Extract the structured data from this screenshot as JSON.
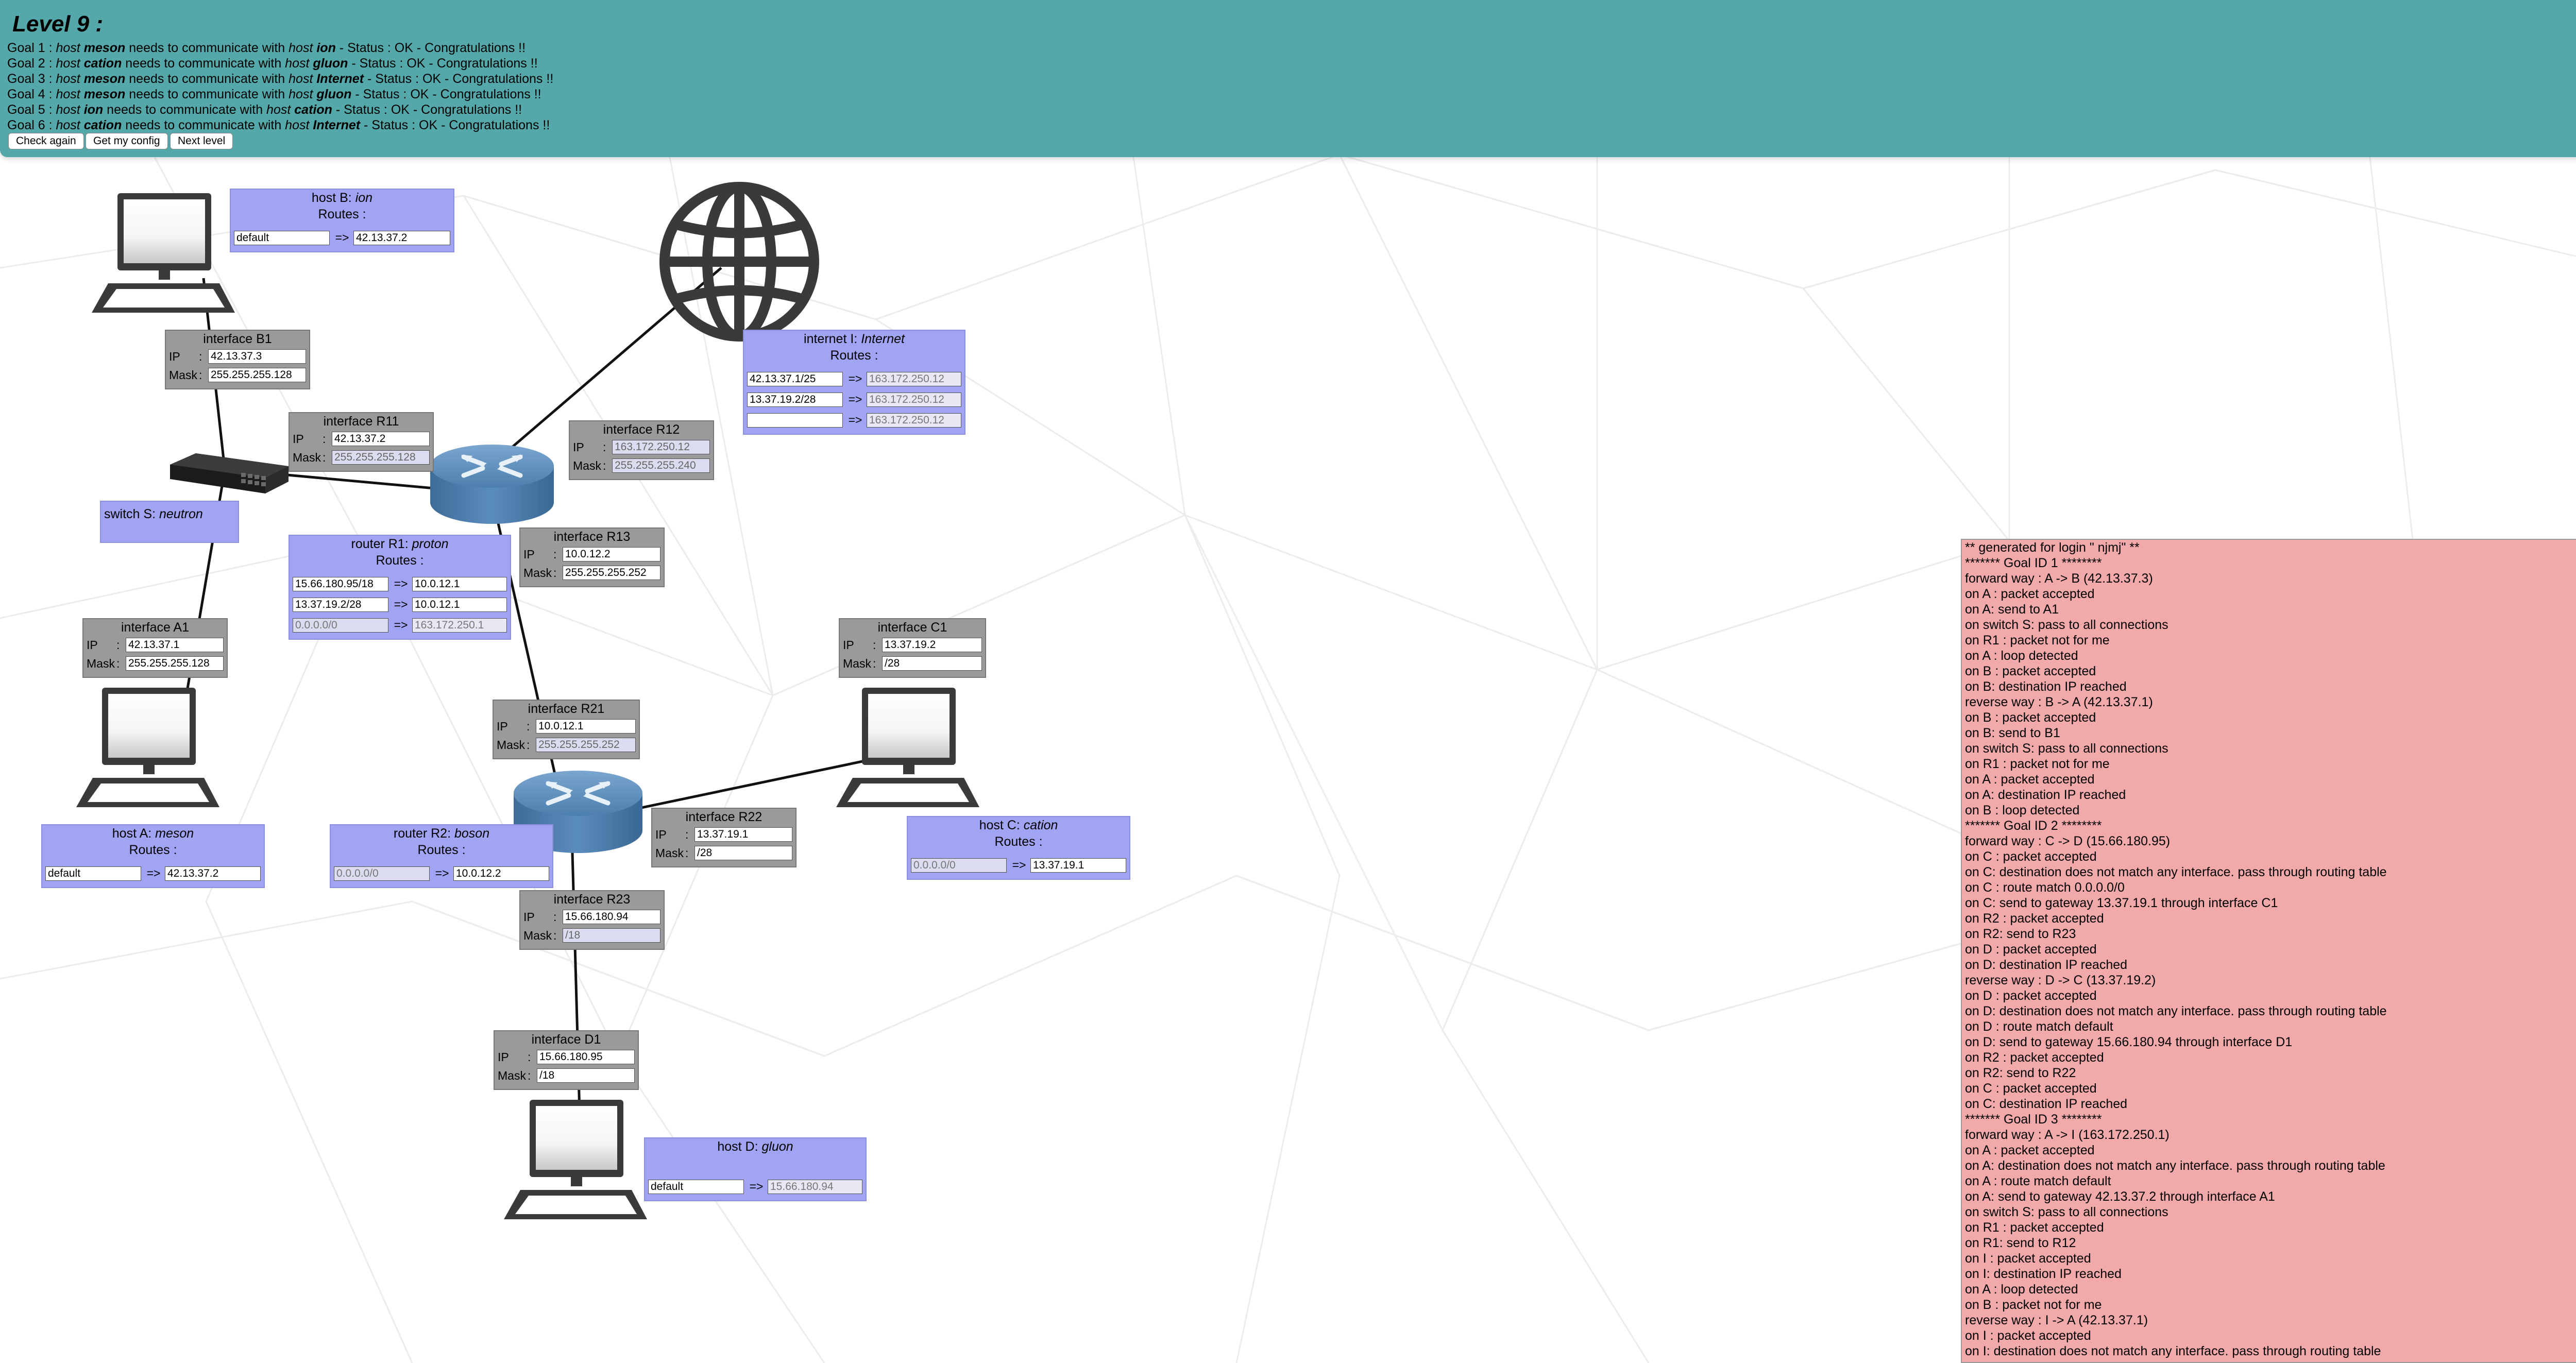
{
  "level_title": "Level 9 :",
  "goals": [
    {
      "prefix": "Goal 1 : ",
      "src_word": "host",
      "src_name": "meson",
      "mid": " needs to communicate with ",
      "dst_word": "host",
      "dst_name": "ion",
      "status": " - Status : OK - Congratulations !!"
    },
    {
      "prefix": "Goal 2 : ",
      "src_word": "host",
      "src_name": "cation",
      "mid": " needs to communicate with ",
      "dst_word": "host",
      "dst_name": "gluon",
      "status": " - Status : OK - Congratulations !!"
    },
    {
      "prefix": "Goal 3 : ",
      "src_word": "host",
      "src_name": "meson",
      "mid": " needs to communicate with ",
      "dst_word": "host",
      "dst_name": "Internet",
      "status": " - Status : OK - Congratulations !!"
    },
    {
      "prefix": "Goal 4 : ",
      "src_word": "host",
      "src_name": "meson",
      "mid": " needs to communicate with ",
      "dst_word": "host",
      "dst_name": "gluon",
      "status": " - Status : OK - Congratulations !!"
    },
    {
      "prefix": "Goal 5 : ",
      "src_word": "host",
      "src_name": "ion",
      "mid": " needs to communicate with ",
      "dst_word": "host",
      "dst_name": "cation",
      "status": " - Status : OK - Congratulations !!"
    },
    {
      "prefix": "Goal 6 : ",
      "src_word": "host",
      "src_name": "cation",
      "mid": " needs to communicate with ",
      "dst_word": "host",
      "dst_name": "Internet",
      "status": " - Status : OK - Congratulations !!"
    }
  ],
  "buttons": {
    "check": "Check again",
    "config": "Get my config",
    "next": "Next level"
  },
  "labels": {
    "ip": "IP",
    "mask": "Mask",
    "colon": ":",
    "routes": "Routes :",
    "arrow": "=>"
  },
  "interfaces": {
    "B1": {
      "title": "interface B1",
      "ip": "42.13.37.3",
      "mask": "255.255.255.128"
    },
    "R11": {
      "title": "interface R11",
      "ip": "42.13.37.2",
      "mask": "255.255.255.128"
    },
    "R12": {
      "title": "interface R12",
      "ip": "163.172.250.12",
      "mask": "255.255.255.240"
    },
    "R13": {
      "title": "interface R13",
      "ip": "10.0.12.2",
      "mask": "255.255.255.252"
    },
    "A1": {
      "title": "interface A1",
      "ip": "42.13.37.1",
      "mask": "255.255.255.128"
    },
    "C1": {
      "title": "interface C1",
      "ip": "13.37.19.2",
      "mask": "/28"
    },
    "R21": {
      "title": "interface R21",
      "ip": "10.0.12.1",
      "mask": "255.255.255.252"
    },
    "R22": {
      "title": "interface R22",
      "ip": "13.37.19.1",
      "mask": "/28"
    },
    "R23": {
      "title": "interface R23",
      "ip": "15.66.180.94",
      "mask": "/18"
    },
    "D1": {
      "title": "interface D1",
      "ip": "15.66.180.95",
      "mask": "/18"
    }
  },
  "hosts": {
    "B": {
      "title_prefix": "host B: ",
      "title_name": "ion",
      "routes": [
        {
          "dest": "default",
          "gw": "42.13.37.2"
        }
      ]
    },
    "I": {
      "title_prefix": "internet I: ",
      "title_name": "Internet",
      "routes": [
        {
          "dest": "42.13.37.1/25",
          "gw": "163.172.250.12"
        },
        {
          "dest": "13.37.19.2/28",
          "gw": "163.172.250.12"
        },
        {
          "dest": "",
          "gw": "163.172.250.12"
        }
      ]
    },
    "R1": {
      "title_prefix": "router R1: ",
      "title_name": "proton",
      "routes": [
        {
          "dest": "15.66.180.95/18",
          "gw": "10.0.12.1"
        },
        {
          "dest": "13.37.19.2/28",
          "gw": "10.0.12.1"
        },
        {
          "dest": "0.0.0.0/0",
          "gw": "163.172.250.1"
        }
      ]
    },
    "A": {
      "title_prefix": "host A: ",
      "title_name": "meson",
      "routes": [
        {
          "dest": "default",
          "gw": "42.13.37.2"
        }
      ]
    },
    "R2": {
      "title_prefix": "router R2: ",
      "title_name": "boson",
      "routes": [
        {
          "dest": "0.0.0.0/0",
          "gw": "10.0.12.2"
        }
      ]
    },
    "C": {
      "title_prefix": "host C: ",
      "title_name": "cation",
      "routes": [
        {
          "dest": "0.0.0.0/0",
          "gw": "13.37.19.1"
        }
      ]
    },
    "D": {
      "title_prefix": "host D: ",
      "title_name": "gluon",
      "routes": [
        {
          "dest": "default",
          "gw": "15.66.180.94"
        }
      ]
    }
  },
  "switch": {
    "title_prefix": "switch S: ",
    "title_name": "neutron"
  },
  "log": [
    "** generated for login \" njmj\" **",
    "******* Goal ID 1 ********",
    "forward way : A -> B (42.13.37.3)",
    "on A : packet accepted",
    "on A: send to A1",
    "on switch S: pass to all connections",
    "on R1 : packet not for me",
    "on A : loop detected",
    "on B : packet accepted",
    "on B: destination IP reached",
    "reverse way : B -> A (42.13.37.1)",
    "on B : packet accepted",
    "on B: send to B1",
    "on switch S: pass to all connections",
    "on R1 : packet not for me",
    "on A : packet accepted",
    "on A: destination IP reached",
    "on B : loop detected",
    "******* Goal ID 2 ********",
    "forward way : C -> D (15.66.180.95)",
    "on C : packet accepted",
    "on C: destination does not match any interface. pass through routing table",
    "on C : route match 0.0.0.0/0",
    "on C: send to gateway 13.37.19.1 through interface C1",
    "on R2 : packet accepted",
    "on R2: send to R23",
    "on D : packet accepted",
    "on D: destination IP reached",
    "reverse way : D -> C (13.37.19.2)",
    "on D : packet accepted",
    "on D: destination does not match any interface. pass through routing table",
    "on D : route match default",
    "on D: send to gateway 15.66.180.94 through interface D1",
    "on R2 : packet accepted",
    "on R2: send to R22",
    "on C : packet accepted",
    "on C: destination IP reached",
    "******* Goal ID 3 ********",
    "forward way : A -> I (163.172.250.1)",
    "on A : packet accepted",
    "on A: destination does not match any interface. pass through routing table",
    "on A : route match default",
    "on A: send to gateway 42.13.37.2 through interface A1",
    "on switch S: pass to all connections",
    "on R1 : packet accepted",
    "on R1: send to R12",
    "on I : packet accepted",
    "on I: destination IP reached",
    "on A : loop detected",
    "on B : packet not for me",
    "reverse way : I -> A (42.13.37.1)",
    "on I : packet accepted",
    "on I: destination does not match any interface. pass through routing table"
  ]
}
